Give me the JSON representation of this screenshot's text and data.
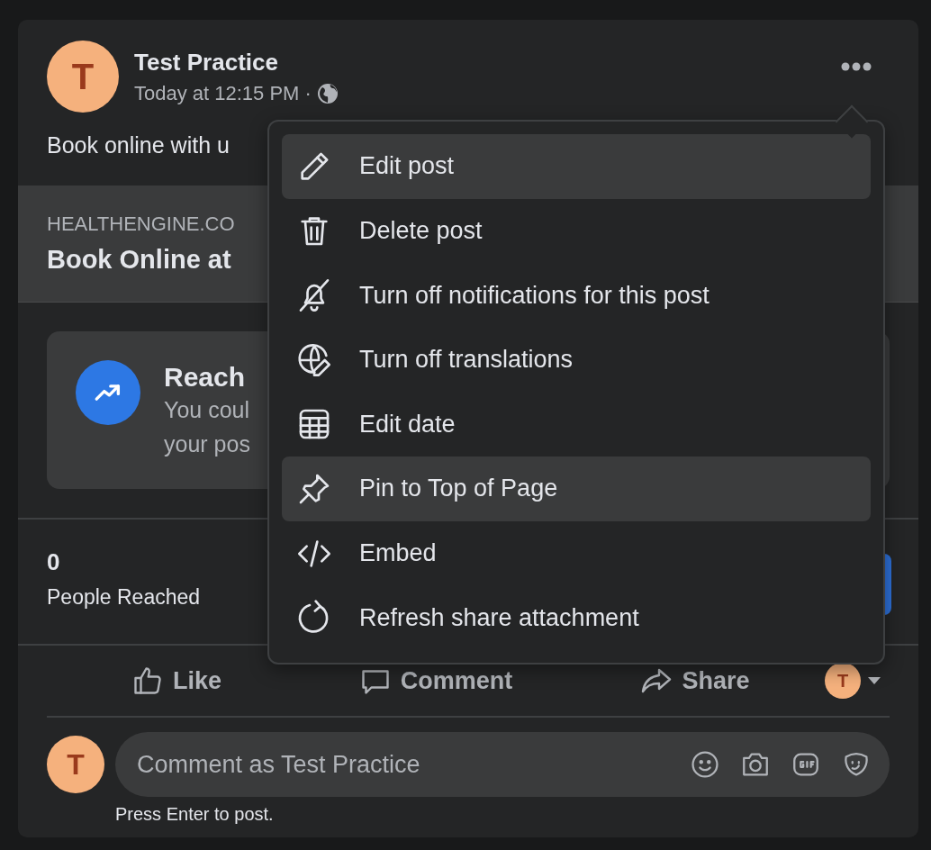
{
  "post": {
    "author": "Test Practice",
    "avatar_letter": "T",
    "time": "Today at 12:15 PM",
    "separator": "·",
    "text": "Book online with u"
  },
  "link_preview": {
    "domain": "HEALTHENGINE.CO",
    "title": "Book Online at"
  },
  "insight": {
    "title": "Reach",
    "body_lines": [
      "You coul",
      "your pos"
    ]
  },
  "stats": {
    "count": "0",
    "label": "People Reached"
  },
  "actions": [
    {
      "kind": "like",
      "label": "Like"
    },
    {
      "kind": "comment",
      "label": "Comment"
    },
    {
      "kind": "share",
      "label": "Share"
    }
  ],
  "actor": {
    "avatar_letter": "T"
  },
  "comment_box": {
    "avatar_letter": "T",
    "placeholder": "Comment as Test Practice",
    "hint": "Press Enter to post."
  },
  "menu": {
    "items": [
      {
        "label": "Edit post",
        "highlighted": true
      },
      {
        "label": "Delete post",
        "highlighted": false
      },
      {
        "label": "Turn off notifications for this post",
        "highlighted": false
      },
      {
        "label": "Turn off translations",
        "highlighted": false
      },
      {
        "label": "Edit date",
        "highlighted": false
      },
      {
        "label": "Pin to Top of Page",
        "highlighted": true
      },
      {
        "label": "Embed",
        "highlighted": false
      },
      {
        "label": "Refresh share attachment",
        "highlighted": false
      }
    ]
  }
}
